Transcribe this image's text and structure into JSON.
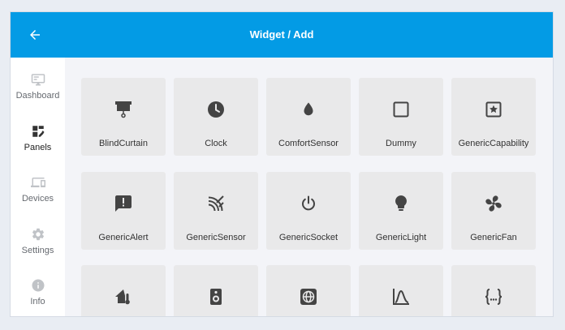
{
  "header": {
    "title": "Widget / Add",
    "back_icon": "arrow-back-icon"
  },
  "colors": {
    "accent": "#039be5",
    "icon_active": "#333333",
    "icon_inactive": "#c0c3c7",
    "tile_bg": "#e9e9ea"
  },
  "sidebar": {
    "items": [
      {
        "label": "Dashboard",
        "icon": "monitor-icon",
        "active": false
      },
      {
        "label": "Panels",
        "icon": "panels-icon",
        "active": true
      },
      {
        "label": "Devices",
        "icon": "devices-icon",
        "active": false
      },
      {
        "label": "Settings",
        "icon": "gear-icon",
        "active": false
      },
      {
        "label": "Info",
        "icon": "info-icon",
        "active": false
      }
    ]
  },
  "widgets": [
    {
      "label": "BlindCurtain",
      "icon": "blind-curtain-icon"
    },
    {
      "label": "Clock",
      "icon": "clock-icon"
    },
    {
      "label": "ComfortSensor",
      "icon": "water-drop-icon"
    },
    {
      "label": "Dummy",
      "icon": "square-outline-icon"
    },
    {
      "label": "GenericCapability",
      "icon": "star-box-icon"
    },
    {
      "label": "GenericAlert",
      "icon": "alert-message-icon"
    },
    {
      "label": "GenericSensor",
      "icon": "sensor-signal-icon"
    },
    {
      "label": "GenericSocket",
      "icon": "power-icon"
    },
    {
      "label": "GenericLight",
      "icon": "lightbulb-icon"
    },
    {
      "label": "GenericFan",
      "icon": "fan-icon"
    },
    {
      "label": "",
      "icon": "home-thermometer-icon"
    },
    {
      "label": "",
      "icon": "speaker-icon"
    },
    {
      "label": "",
      "icon": "globe-icon"
    },
    {
      "label": "",
      "icon": "bell-curve-icon"
    },
    {
      "label": "",
      "icon": "code-braces-icon"
    }
  ]
}
